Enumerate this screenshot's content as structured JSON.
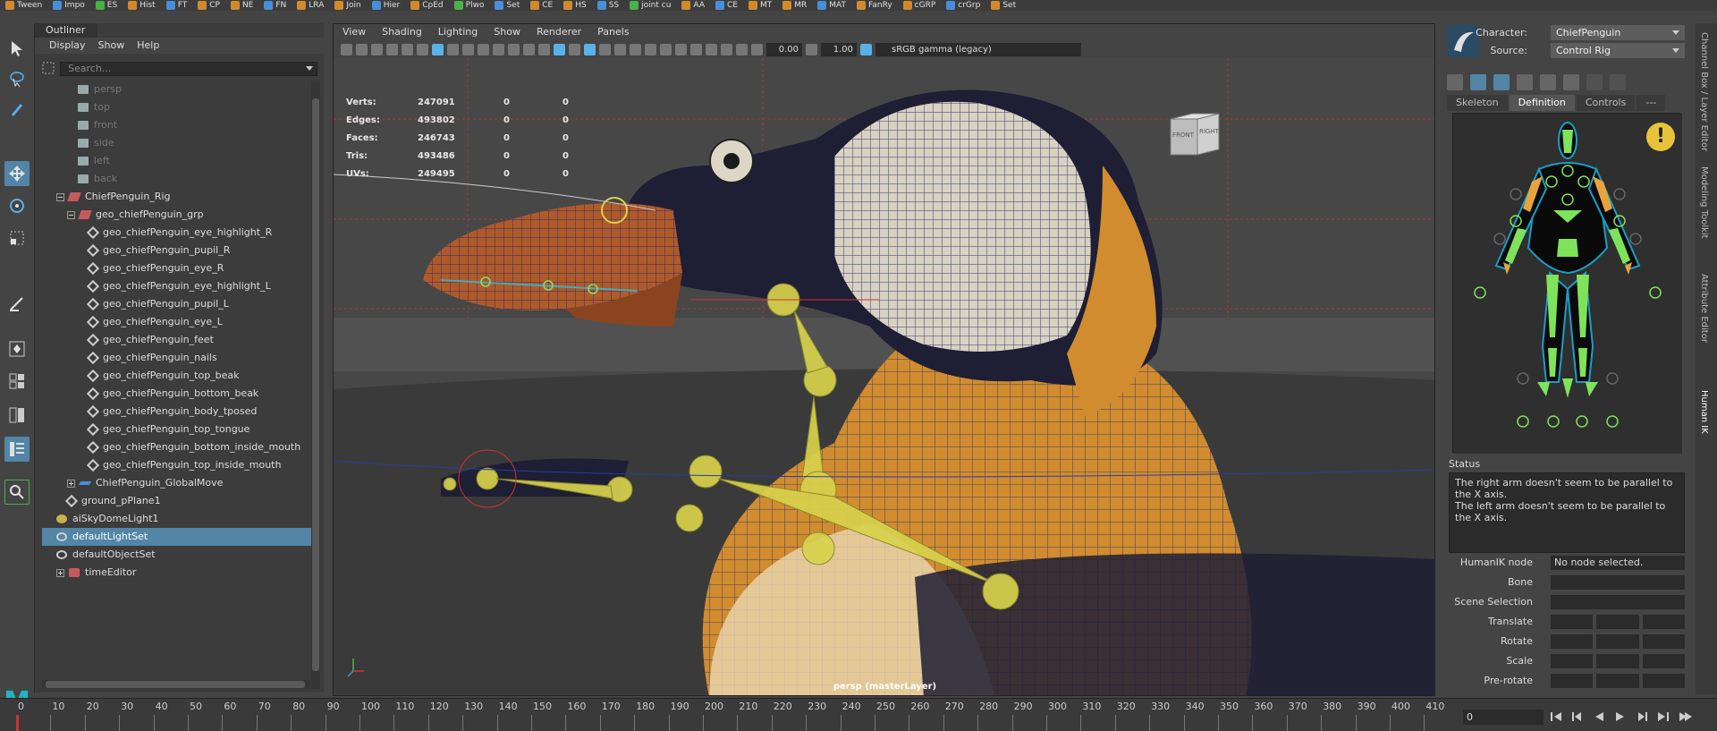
{
  "shelf": {
    "buttons": [
      "Tween",
      "Impo",
      "ES",
      "Hist",
      "FT",
      "CP",
      "NE",
      "FN",
      "LRA",
      "Join",
      "Hier",
      "CpEd",
      "Plwo",
      "Set",
      "CE",
      "HS",
      "SS",
      "joint cu",
      "AA",
      "CE",
      "MT",
      "MR",
      "MAT",
      "FanRy",
      "cGRP",
      "crGrp",
      "Set"
    ]
  },
  "outliner": {
    "title": "Outliner",
    "menu": [
      "Display",
      "Show",
      "Help"
    ],
    "search_placeholder": "Search...",
    "items": [
      {
        "label": "persp",
        "icon": "camera-icon",
        "dim": true
      },
      {
        "label": "top",
        "icon": "camera-icon",
        "dim": true
      },
      {
        "label": "front",
        "icon": "camera-icon",
        "dim": true
      },
      {
        "label": "side",
        "icon": "camera-icon",
        "dim": true
      },
      {
        "label": "left",
        "icon": "camera-icon",
        "dim": true
      },
      {
        "label": "back",
        "icon": "camera-icon",
        "dim": true
      },
      {
        "label": "ChiefPenguin_Rig",
        "icon": "rig-icon"
      },
      {
        "label": "geo_chiefPenguin_grp",
        "icon": "rig-icon"
      },
      {
        "label": "geo_chiefPenguin_eye_highlight_R",
        "icon": "mesh-icon"
      },
      {
        "label": "geo_chiefPenguin_pupil_R",
        "icon": "mesh-icon"
      },
      {
        "label": "geo_chiefPenguin_eye_R",
        "icon": "mesh-icon"
      },
      {
        "label": "geo_chiefPenguin_eye_highlight_L",
        "icon": "mesh-icon"
      },
      {
        "label": "geo_chiefPenguin_pupil_L",
        "icon": "mesh-icon"
      },
      {
        "label": "geo_chiefPenguin_eye_L",
        "icon": "mesh-icon"
      },
      {
        "label": "geo_chiefPenguin_feet",
        "icon": "mesh-icon"
      },
      {
        "label": "geo_chiefPenguin_nails",
        "icon": "mesh-icon"
      },
      {
        "label": "geo_chiefPenguin_top_beak",
        "icon": "mesh-icon"
      },
      {
        "label": "geo_chiefPenguin_bottom_beak",
        "icon": "mesh-icon"
      },
      {
        "label": "geo_chiefPenguin_body_tposed",
        "icon": "mesh-icon"
      },
      {
        "label": "geo_chiefPenguin_top_tongue",
        "icon": "mesh-icon"
      },
      {
        "label": "geo_chiefPenguin_bottom_inside_mouth",
        "icon": "mesh-icon"
      },
      {
        "label": "geo_chiefPenguin_top_inside_mouth",
        "icon": "mesh-icon"
      },
      {
        "label": "ChiefPenguin_GlobalMove",
        "icon": "move-icon"
      },
      {
        "label": "ground_pPlane1",
        "icon": "mesh-icon"
      },
      {
        "label": "aiSkyDomeLight1",
        "icon": "light-icon"
      },
      {
        "label": "defaultLightSet",
        "icon": "set-icon",
        "selected": true
      },
      {
        "label": "defaultObjectSet",
        "icon": "set-icon"
      },
      {
        "label": "timeEditor",
        "icon": "time-icon"
      }
    ]
  },
  "viewport": {
    "menu": [
      "View",
      "Shading",
      "Lighting",
      "Show",
      "Renderer",
      "Panels"
    ],
    "exposure": "0.00",
    "gamma": "1.00",
    "color_space": "sRGB gamma (legacy)",
    "hud": [
      {
        "key": "Verts:",
        "value": "247091",
        "a": "0",
        "b": "0"
      },
      {
        "key": "Edges:",
        "value": "493802",
        "a": "0",
        "b": "0"
      },
      {
        "key": "Faces:",
        "value": "246743",
        "a": "0",
        "b": "0"
      },
      {
        "key": "Tris:",
        "value": "493486",
        "a": "0",
        "b": "0"
      },
      {
        "key": "UVs:",
        "value": "249495",
        "a": "0",
        "b": "0"
      }
    ],
    "viewcube_front": "FRONT",
    "viewcube_right": "RIGHT",
    "camera_label": "persp (masterLayer)"
  },
  "humanik": {
    "character_label": "Character:",
    "character_value": "ChiefPenguin",
    "source_label": "Source:",
    "source_value": "Control Rig",
    "tabs": [
      "Skeleton",
      "Definition",
      "Controls",
      "---"
    ],
    "active_tab": "Definition",
    "status_title": "Status",
    "status_lines": [
      "The right arm doesn't seem to be parallel to the X axis.",
      "The left arm doesn't seem to be parallel to the X axis."
    ],
    "props": [
      {
        "label": "HumanIK node",
        "value": "No node selected."
      },
      {
        "label": "Bone",
        "value": ""
      },
      {
        "label": "Scene Selection",
        "value": ""
      },
      {
        "label": "Translate",
        "value": ""
      },
      {
        "label": "Rotate",
        "value": ""
      },
      {
        "label": "Scale",
        "value": ""
      },
      {
        "label": "Pre-rotate",
        "value": ""
      }
    ]
  },
  "side_tabs": [
    "Channel Box / Layer Editor",
    "Modeling Toolkit",
    "Attribute Editor",
    "Human IK"
  ],
  "timeline": {
    "ticks": [
      "0",
      "10",
      "20",
      "30",
      "40",
      "50",
      "60",
      "70",
      "80",
      "90",
      "100",
      "110",
      "120",
      "130",
      "140",
      "150",
      "160",
      "170",
      "180",
      "190",
      "200",
      "210",
      "220",
      "230",
      "240",
      "250",
      "260",
      "270",
      "280",
      "290",
      "300",
      "310",
      "320",
      "330",
      "340",
      "350",
      "360",
      "370",
      "380",
      "390",
      "400",
      "410"
    ],
    "current_frame": "0"
  },
  "colors": {
    "selection": "#5285a6",
    "accent": "#1fb6c2",
    "rig_green": "#7ee35a",
    "rig_orange": "#e8a43a"
  }
}
